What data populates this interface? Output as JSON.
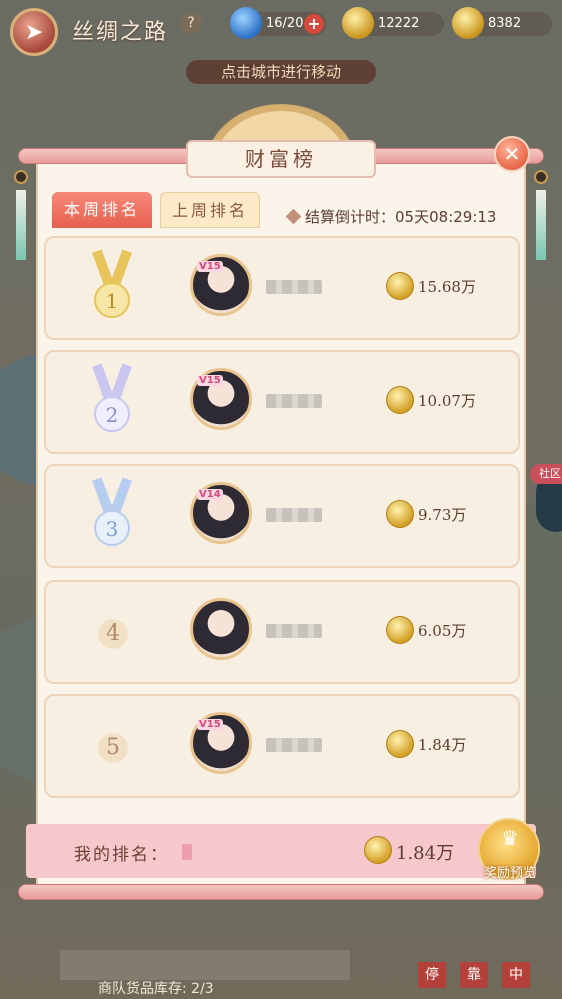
{
  "header": {
    "title": "丝绸之路",
    "help_icon": "question-icon",
    "energy": "16/20",
    "gold": "12222",
    "coins": "8382"
  },
  "hint": "点击城市进行移动",
  "panel": {
    "title": "财富榜",
    "tabs": [
      "本周排名",
      "上周排名"
    ],
    "active_tab": 0,
    "countdown_label": "结算倒计时：",
    "countdown": "05天08:29:13"
  },
  "ranking": [
    {
      "rank": "1",
      "vip": "V15",
      "amount": "15.68万"
    },
    {
      "rank": "2",
      "vip": "V15",
      "amount": "10.07万"
    },
    {
      "rank": "3",
      "vip": "V14",
      "amount": "9.73万"
    },
    {
      "rank": "4",
      "vip": "",
      "amount": "6.05万"
    },
    {
      "rank": "5",
      "vip": "V15",
      "amount": "1.84万"
    }
  ],
  "my_rank": {
    "label": "我的排名：",
    "amount": "1.84万"
  },
  "reward_preview": "奖励预览",
  "side_label": "社区",
  "footer": {
    "stock": "商队货品库存: 2/3",
    "dock_buttons": [
      "停",
      "靠",
      "中"
    ]
  },
  "colors": {
    "gold_medal": "#e8c55a",
    "silver_medal": "#c9c7f0",
    "bronze_medal": "#b6cdf0",
    "tab_active": "#ee6b59"
  }
}
